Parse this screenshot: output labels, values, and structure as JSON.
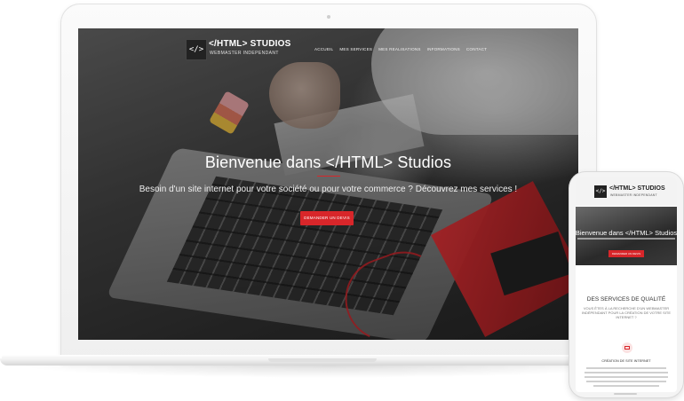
{
  "desktop_site": {
    "logo_symbol": "</>",
    "brand": "</HTML> STUDIOS",
    "tagline": "WEBMASTER INDEPENDANT",
    "nav": [
      "ACCUEIL",
      "MES SERVICES",
      "MES REALISATIONS",
      "INFORMATIONS",
      "CONTACT"
    ],
    "hero_title": "Bienvenue dans </HTML> Studios",
    "hero_subtitle": "Besoin d'un site internet pour votre société ou pour votre commerce ? Découvrez mes services !",
    "cta_label": "DEMANDER UN DEVIS",
    "accent_color": "#d8262a"
  },
  "mobile_site": {
    "logo_symbol": "</>",
    "brand": "</HTML> STUDIOS",
    "tagline": "WEBMASTER INDEPENDANT",
    "hero_title": "Bienvenue dans </HTML> Studios",
    "cta_label": "DEMANDER UN DEVIS",
    "section_title": "DES SERVICES DE QUALITÉ",
    "section_subtitle": "VOUS ÊTES À LA RECHERCHE D'UN WEBMASTER INDÉPENDANT POUR LA CRÉATION DE VOTRE SITE INTERNET ?",
    "service_icon": "computer-icon",
    "service_title": "CRÉATION DE SITE INTERNET"
  }
}
